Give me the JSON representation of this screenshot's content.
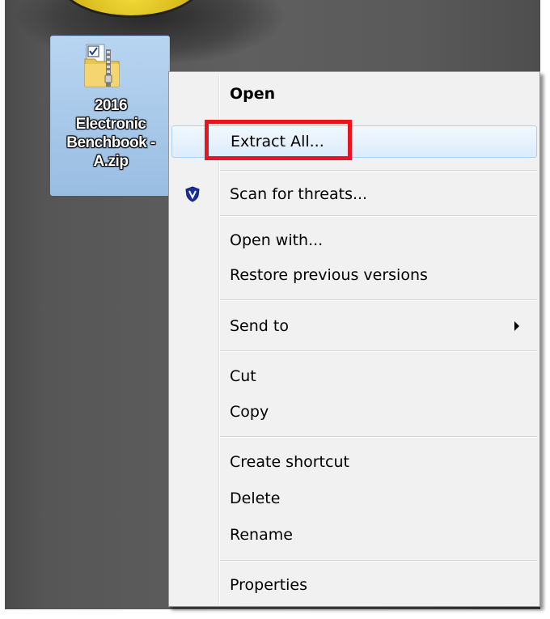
{
  "desktop": {
    "icon": {
      "label_lines": [
        "2016",
        "Electronic",
        "Benchbook -",
        "A.zip"
      ],
      "type": "zip-folder-icon"
    }
  },
  "context_menu": {
    "items": [
      {
        "label": "Open",
        "bold": true
      },
      {
        "label": "Extract All...",
        "hover": true,
        "highlighted": true
      },
      {
        "label": "Scan for threats...",
        "icon": "shield-icon"
      },
      {
        "label": "Open with..."
      },
      {
        "label": "Restore previous versions"
      },
      {
        "label": "Send to",
        "submenu": true
      },
      {
        "label": "Cut"
      },
      {
        "label": "Copy"
      },
      {
        "label": "Create shortcut"
      },
      {
        "label": "Delete"
      },
      {
        "label": "Rename"
      },
      {
        "label": "Properties"
      }
    ]
  },
  "colors": {
    "highlight_box": "#e8141f",
    "menu_background": "#f1f1f1",
    "hover_border": "#a8d3f5"
  }
}
